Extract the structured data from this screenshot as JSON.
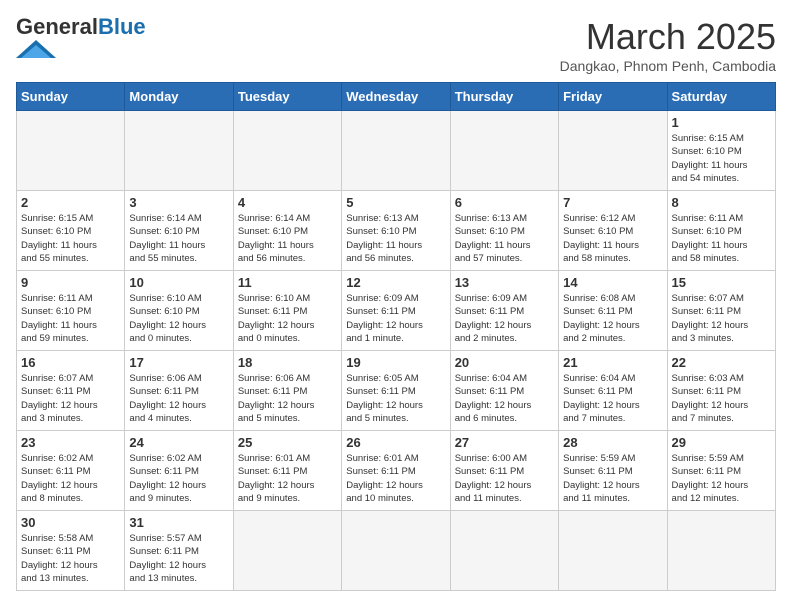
{
  "header": {
    "logo_general": "General",
    "logo_blue": "Blue",
    "month_title": "March 2025",
    "subtitle": "Dangkao, Phnom Penh, Cambodia"
  },
  "weekdays": [
    "Sunday",
    "Monday",
    "Tuesday",
    "Wednesday",
    "Thursday",
    "Friday",
    "Saturday"
  ],
  "weeks": [
    [
      {
        "day": "",
        "info": ""
      },
      {
        "day": "",
        "info": ""
      },
      {
        "day": "",
        "info": ""
      },
      {
        "day": "",
        "info": ""
      },
      {
        "day": "",
        "info": ""
      },
      {
        "day": "",
        "info": ""
      },
      {
        "day": "1",
        "info": "Sunrise: 6:15 AM\nSunset: 6:10 PM\nDaylight: 11 hours\nand 54 minutes."
      }
    ],
    [
      {
        "day": "2",
        "info": "Sunrise: 6:15 AM\nSunset: 6:10 PM\nDaylight: 11 hours\nand 55 minutes."
      },
      {
        "day": "3",
        "info": "Sunrise: 6:14 AM\nSunset: 6:10 PM\nDaylight: 11 hours\nand 55 minutes."
      },
      {
        "day": "4",
        "info": "Sunrise: 6:14 AM\nSunset: 6:10 PM\nDaylight: 11 hours\nand 56 minutes."
      },
      {
        "day": "5",
        "info": "Sunrise: 6:13 AM\nSunset: 6:10 PM\nDaylight: 11 hours\nand 56 minutes."
      },
      {
        "day": "6",
        "info": "Sunrise: 6:13 AM\nSunset: 6:10 PM\nDaylight: 11 hours\nand 57 minutes."
      },
      {
        "day": "7",
        "info": "Sunrise: 6:12 AM\nSunset: 6:10 PM\nDaylight: 11 hours\nand 58 minutes."
      },
      {
        "day": "8",
        "info": "Sunrise: 6:11 AM\nSunset: 6:10 PM\nDaylight: 11 hours\nand 58 minutes."
      }
    ],
    [
      {
        "day": "9",
        "info": "Sunrise: 6:11 AM\nSunset: 6:10 PM\nDaylight: 11 hours\nand 59 minutes."
      },
      {
        "day": "10",
        "info": "Sunrise: 6:10 AM\nSunset: 6:10 PM\nDaylight: 12 hours\nand 0 minutes."
      },
      {
        "day": "11",
        "info": "Sunrise: 6:10 AM\nSunset: 6:11 PM\nDaylight: 12 hours\nand 0 minutes."
      },
      {
        "day": "12",
        "info": "Sunrise: 6:09 AM\nSunset: 6:11 PM\nDaylight: 12 hours\nand 1 minute."
      },
      {
        "day": "13",
        "info": "Sunrise: 6:09 AM\nSunset: 6:11 PM\nDaylight: 12 hours\nand 2 minutes."
      },
      {
        "day": "14",
        "info": "Sunrise: 6:08 AM\nSunset: 6:11 PM\nDaylight: 12 hours\nand 2 minutes."
      },
      {
        "day": "15",
        "info": "Sunrise: 6:07 AM\nSunset: 6:11 PM\nDaylight: 12 hours\nand 3 minutes."
      }
    ],
    [
      {
        "day": "16",
        "info": "Sunrise: 6:07 AM\nSunset: 6:11 PM\nDaylight: 12 hours\nand 3 minutes."
      },
      {
        "day": "17",
        "info": "Sunrise: 6:06 AM\nSunset: 6:11 PM\nDaylight: 12 hours\nand 4 minutes."
      },
      {
        "day": "18",
        "info": "Sunrise: 6:06 AM\nSunset: 6:11 PM\nDaylight: 12 hours\nand 5 minutes."
      },
      {
        "day": "19",
        "info": "Sunrise: 6:05 AM\nSunset: 6:11 PM\nDaylight: 12 hours\nand 5 minutes."
      },
      {
        "day": "20",
        "info": "Sunrise: 6:04 AM\nSunset: 6:11 PM\nDaylight: 12 hours\nand 6 minutes."
      },
      {
        "day": "21",
        "info": "Sunrise: 6:04 AM\nSunset: 6:11 PM\nDaylight: 12 hours\nand 7 minutes."
      },
      {
        "day": "22",
        "info": "Sunrise: 6:03 AM\nSunset: 6:11 PM\nDaylight: 12 hours\nand 7 minutes."
      }
    ],
    [
      {
        "day": "23",
        "info": "Sunrise: 6:02 AM\nSunset: 6:11 PM\nDaylight: 12 hours\nand 8 minutes."
      },
      {
        "day": "24",
        "info": "Sunrise: 6:02 AM\nSunset: 6:11 PM\nDaylight: 12 hours\nand 9 minutes."
      },
      {
        "day": "25",
        "info": "Sunrise: 6:01 AM\nSunset: 6:11 PM\nDaylight: 12 hours\nand 9 minutes."
      },
      {
        "day": "26",
        "info": "Sunrise: 6:01 AM\nSunset: 6:11 PM\nDaylight: 12 hours\nand 10 minutes."
      },
      {
        "day": "27",
        "info": "Sunrise: 6:00 AM\nSunset: 6:11 PM\nDaylight: 12 hours\nand 11 minutes."
      },
      {
        "day": "28",
        "info": "Sunrise: 5:59 AM\nSunset: 6:11 PM\nDaylight: 12 hours\nand 11 minutes."
      },
      {
        "day": "29",
        "info": "Sunrise: 5:59 AM\nSunset: 6:11 PM\nDaylight: 12 hours\nand 12 minutes."
      }
    ],
    [
      {
        "day": "30",
        "info": "Sunrise: 5:58 AM\nSunset: 6:11 PM\nDaylight: 12 hours\nand 13 minutes."
      },
      {
        "day": "31",
        "info": "Sunrise: 5:57 AM\nSunset: 6:11 PM\nDaylight: 12 hours\nand 13 minutes."
      },
      {
        "day": "",
        "info": ""
      },
      {
        "day": "",
        "info": ""
      },
      {
        "day": "",
        "info": ""
      },
      {
        "day": "",
        "info": ""
      },
      {
        "day": "",
        "info": ""
      }
    ]
  ]
}
